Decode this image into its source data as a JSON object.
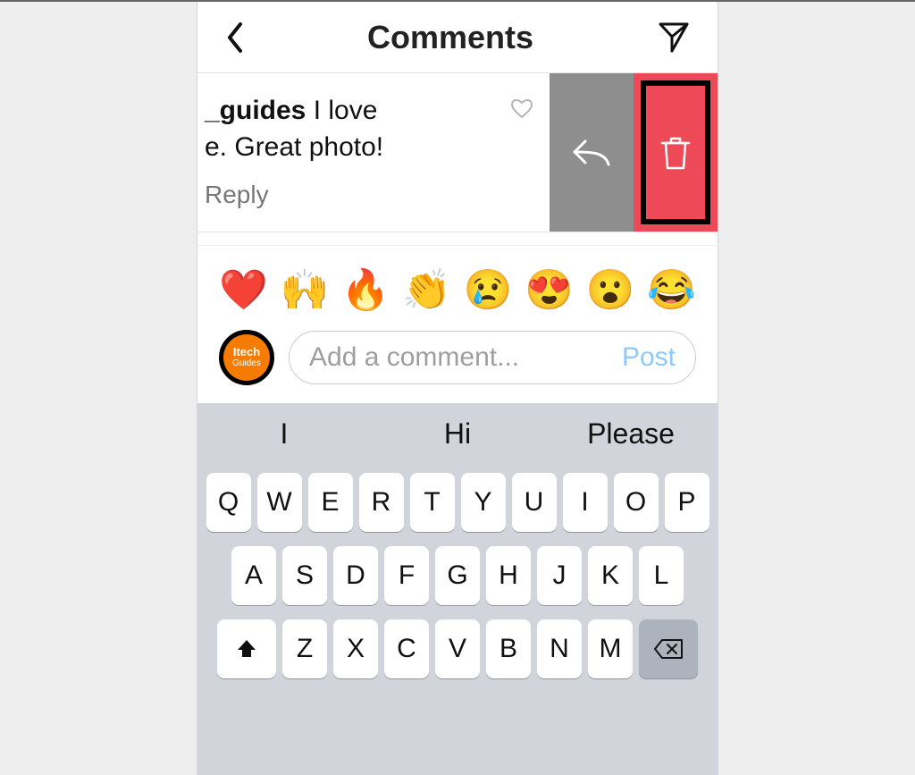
{
  "header": {
    "title": "Comments"
  },
  "comment": {
    "username_fragment": "_guides",
    "text_line1": " I love",
    "text_line2": "e. Great photo!",
    "reply_label": "Reply"
  },
  "emojis": [
    "❤️",
    "🙌",
    "🔥",
    "👏",
    "😢",
    "😍",
    "😮",
    "😂"
  ],
  "avatar": {
    "line1": "Itech",
    "line2": "Guides"
  },
  "compose": {
    "placeholder": "Add a comment...",
    "post_label": "Post"
  },
  "keyboard": {
    "suggestions": [
      "I",
      "Hi",
      "Please"
    ],
    "row1": [
      "Q",
      "W",
      "E",
      "R",
      "T",
      "Y",
      "U",
      "I",
      "O",
      "P"
    ],
    "row2": [
      "A",
      "S",
      "D",
      "F",
      "G",
      "H",
      "J",
      "K",
      "L"
    ],
    "row3": [
      "Z",
      "X",
      "C",
      "V",
      "B",
      "N",
      "M"
    ]
  }
}
